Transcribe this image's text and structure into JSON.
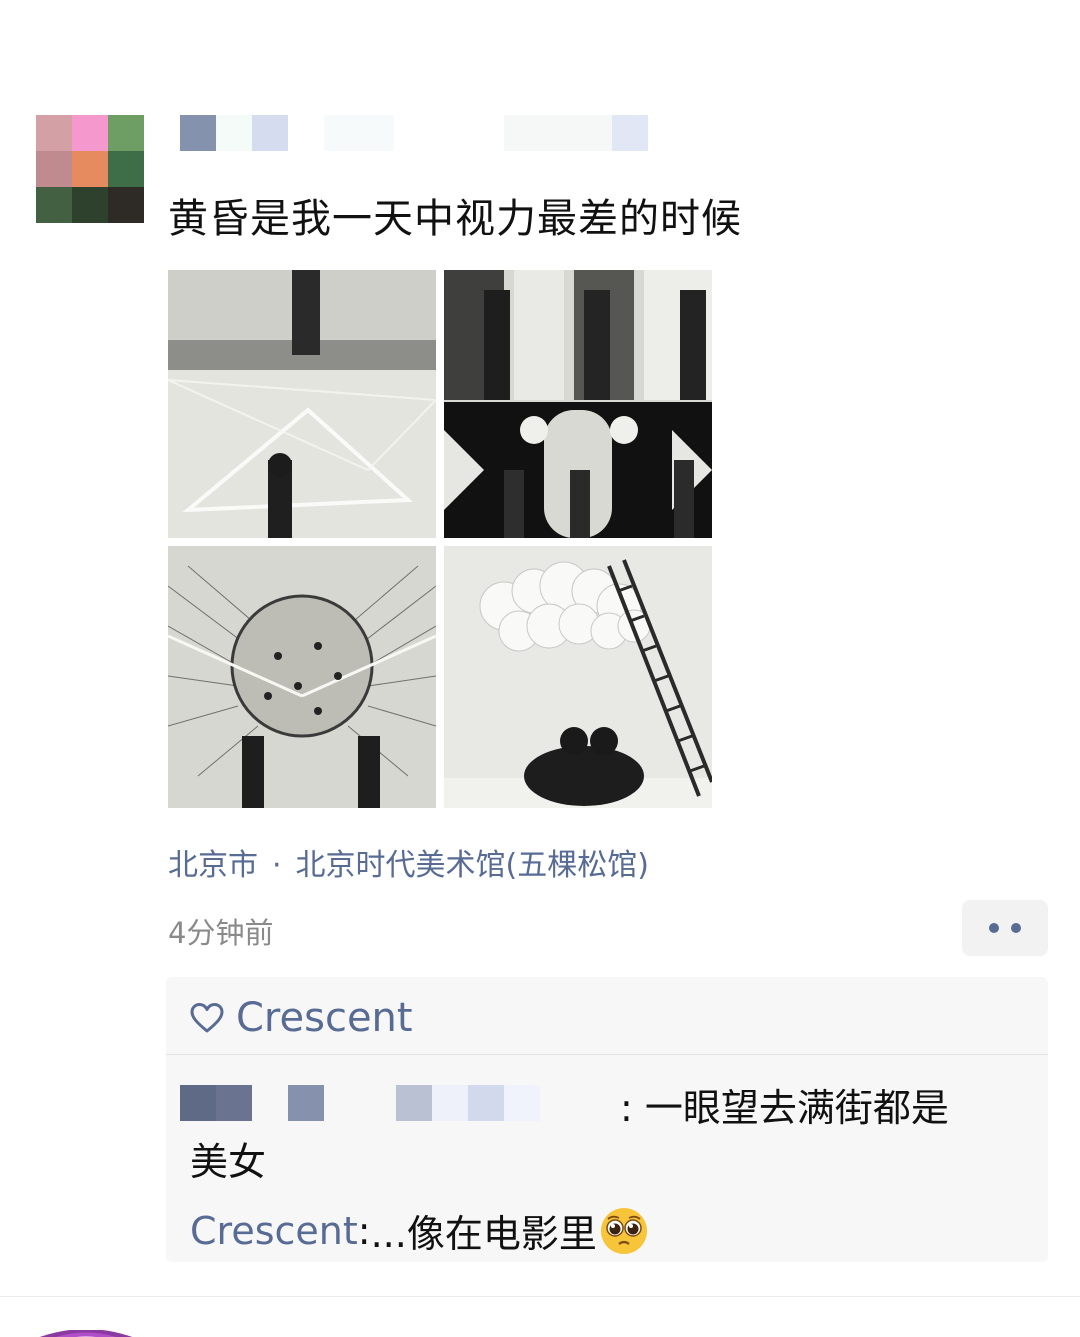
{
  "post": {
    "text": "黄昏是我一天中视力最差的时候",
    "location": {
      "city": "北京市",
      "separator": "·",
      "place": "北京时代美术馆(五棵松馆)"
    },
    "time": "4分钟前"
  },
  "avatar_colors": [
    "#d3a0a6",
    "#f598cd",
    "#6e9e64",
    "#bf8b8f",
    "#e68b5f",
    "#3d6e47",
    "#436042",
    "#2e412d",
    "#2e2a25"
  ],
  "likes": {
    "icon": "heart-icon",
    "names": "Crescent"
  },
  "comments": [
    {
      "text_line1": ": 一眼望去满街都是",
      "text_line2": "美女"
    },
    {
      "author": "Crescent",
      "colon": ":",
      "text": " ...像在电影里",
      "emoji": "pleading-face-emoji"
    }
  ],
  "colors": {
    "link": "#576b95",
    "text": "#111111",
    "secondary": "#8a8a8a",
    "panel": "#f7f7f7"
  }
}
